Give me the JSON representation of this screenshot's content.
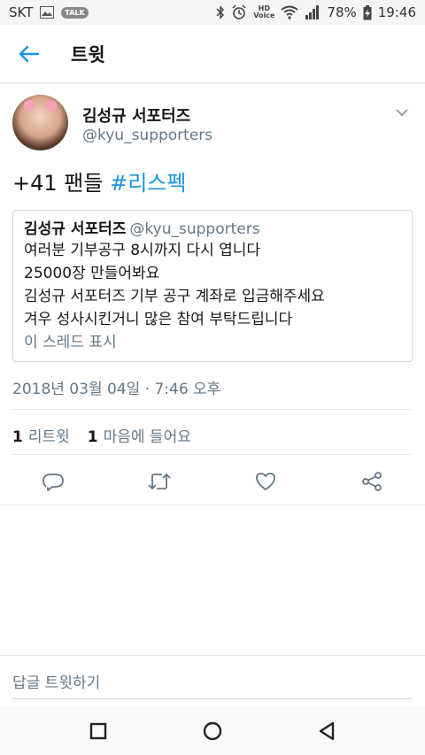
{
  "status_bar": {
    "carrier": "SKT",
    "talk": "TALK",
    "hd": "HD",
    "voice": "Voice",
    "battery": "78%",
    "time": "19:46"
  },
  "header": {
    "title": "트윗"
  },
  "tweet": {
    "display_name": "김성규 서포터즈",
    "handle": "@kyu_supporters",
    "text_prefix": "+41 팬들 ",
    "hashtag": "#리스펙",
    "quote": {
      "display_name": "김성규 서포터즈",
      "handle": "@kyu_supporters",
      "lines": [
        "여러분 기부공구 8시까지 다시 엽니다",
        "25000장 만들어봐요",
        "김성규 서포터즈 기부 공구 계좌로 입금해주세요",
        "겨우 성사시킨거니 많은 참여 부탁드립니다"
      ],
      "show_thread": "이 스레드 표시"
    },
    "timestamp": "2018년 03월 04일 · 7:46 오후",
    "stats": {
      "retweets_count": "1",
      "retweets_label": "리트윗",
      "likes_count": "1",
      "likes_label": "마음에 들어요"
    }
  },
  "reply": {
    "placeholder": "답글 트윗하기"
  },
  "colors": {
    "accent": "#1b95e0",
    "muted": "#657786",
    "border": "#e1e8ed"
  }
}
